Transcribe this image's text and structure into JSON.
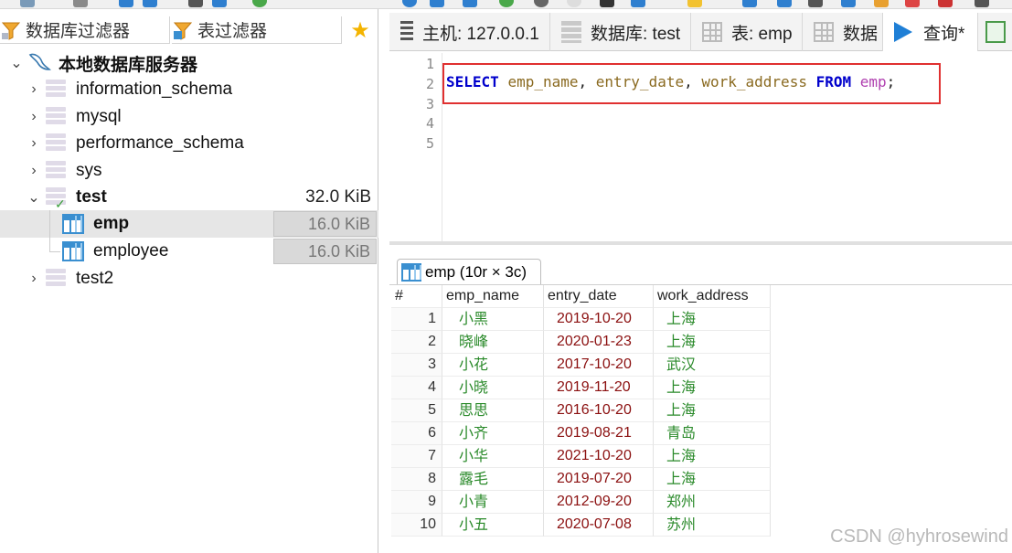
{
  "filters": {
    "db_filter": "数据库过滤器",
    "table_filter": "表过滤器"
  },
  "tree": {
    "server": "本地数据库服务器",
    "databases": [
      {
        "name": "information_schema"
      },
      {
        "name": "mysql"
      },
      {
        "name": "performance_schema"
      },
      {
        "name": "sys"
      },
      {
        "name": "test",
        "size": "32.0 KiB",
        "expanded": true,
        "tables": [
          {
            "name": "emp",
            "size": "16.0 KiB",
            "selected": true
          },
          {
            "name": "employee",
            "size": "16.0 KiB"
          }
        ]
      },
      {
        "name": "test2"
      }
    ]
  },
  "tabs": {
    "host": "主机: 127.0.0.1",
    "database": "数据库: test",
    "table": "表: emp",
    "data": "数据",
    "query": "查询*"
  },
  "editor": {
    "line_numbers": [
      "1",
      "2",
      "3",
      "4",
      "5"
    ],
    "sql_tokens": {
      "select": "SELECT",
      "col1": "emp_name",
      "comma1": ", ",
      "col2": "entry_date",
      "comma2": ", ",
      "col3": "work_address",
      "from": "FROM",
      "table": "emp",
      "semi": ";"
    }
  },
  "result": {
    "tab_label": "emp (10r × 3c)",
    "columns": [
      "#",
      "emp_name",
      "entry_date",
      "work_address"
    ],
    "rows": [
      [
        "1",
        "小黑",
        "2019-10-20",
        "上海"
      ],
      [
        "2",
        "晓峰",
        "2020-01-23",
        "上海"
      ],
      [
        "3",
        "小花",
        "2017-10-20",
        "武汉"
      ],
      [
        "4",
        "小晓",
        "2019-11-20",
        "上海"
      ],
      [
        "5",
        "思思",
        "2016-10-20",
        "上海"
      ],
      [
        "6",
        "小齐",
        "2019-08-21",
        "青岛"
      ],
      [
        "7",
        "小华",
        "2021-10-20",
        "上海"
      ],
      [
        "8",
        "露毛",
        "2019-07-20",
        "上海"
      ],
      [
        "9",
        "小青",
        "2012-09-20",
        "郑州"
      ],
      [
        "10",
        "小五",
        "2020-07-08",
        "苏州"
      ]
    ]
  },
  "watermark": "CSDN @hyhrosewind",
  "colors": {
    "keyword": "#0000cc",
    "identifier": "#8a6a20",
    "table_name": "#b040b0",
    "highlight_border": "#e03030",
    "text_green": "#2a8a2a",
    "date_red": "#8b1010"
  }
}
